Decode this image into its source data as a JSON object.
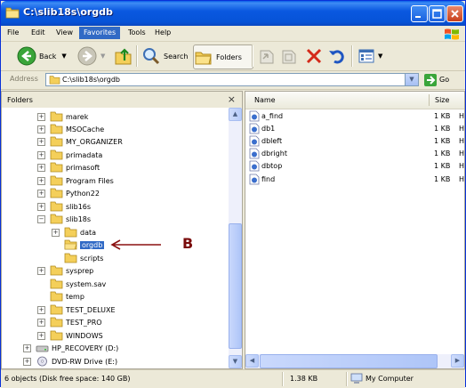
{
  "window": {
    "title": "C:\\slib18s\\orgdb"
  },
  "menu": {
    "items": [
      "File",
      "Edit",
      "View",
      "Favorites",
      "Tools",
      "Help"
    ],
    "active": "Favorites"
  },
  "toolbar": {
    "back_label": "Back",
    "search_label": "Search",
    "folders_label": "Folders"
  },
  "address": {
    "label": "Address",
    "value": "C:\\slib18s\\orgdb",
    "go_label": "Go"
  },
  "left_pane": {
    "title": "Folders",
    "tree": [
      {
        "label": "marek",
        "expander": "+"
      },
      {
        "label": "MSOCache",
        "expander": "+"
      },
      {
        "label": "MY_ORGANIZER",
        "expander": "+"
      },
      {
        "label": "primadata",
        "expander": "+"
      },
      {
        "label": "primasoft",
        "expander": "+"
      },
      {
        "label": "Program Files",
        "expander": "+"
      },
      {
        "label": "Python22",
        "expander": "+"
      },
      {
        "label": "slib16s",
        "expander": "+"
      },
      {
        "label": "slib18s",
        "expander": "−"
      },
      {
        "label": "data",
        "expander": "+"
      },
      {
        "label": "orgdb",
        "expander": ""
      },
      {
        "label": "scripts",
        "expander": ""
      },
      {
        "label": "sysprep",
        "expander": "+"
      },
      {
        "label": "system.sav",
        "expander": ""
      },
      {
        "label": "temp",
        "expander": ""
      },
      {
        "label": "TEST_DELUXE",
        "expander": "+"
      },
      {
        "label": "TEST_PRO",
        "expander": "+"
      },
      {
        "label": "WINDOWS",
        "expander": "+"
      },
      {
        "label": "HP_RECOVERY (D:)",
        "expander": "+"
      },
      {
        "label": "DVD-RW Drive (E:)",
        "expander": "+"
      }
    ]
  },
  "annotation": {
    "label": "B"
  },
  "right_pane": {
    "columns": {
      "name": "Name",
      "size": "Size"
    },
    "files": [
      {
        "name": "a_find",
        "size": "1 KB",
        "extra": "H"
      },
      {
        "name": "db1",
        "size": "1 KB",
        "extra": "H"
      },
      {
        "name": "dbleft",
        "size": "1 KB",
        "extra": "H"
      },
      {
        "name": "dbright",
        "size": "1 KB",
        "extra": "H"
      },
      {
        "name": "dbtop",
        "size": "1 KB",
        "extra": "H"
      },
      {
        "name": "find",
        "size": "1 KB",
        "extra": "H"
      }
    ]
  },
  "status": {
    "objects": "6 objects (Disk free space: 140 GB)",
    "size": "1.38 KB",
    "location": "My Computer"
  },
  "colors": {
    "title_blue": "#0653d7",
    "selection": "#316ac5",
    "folder_yellow": "#f4cf5a",
    "annotation_red": "#7a0c0c"
  }
}
